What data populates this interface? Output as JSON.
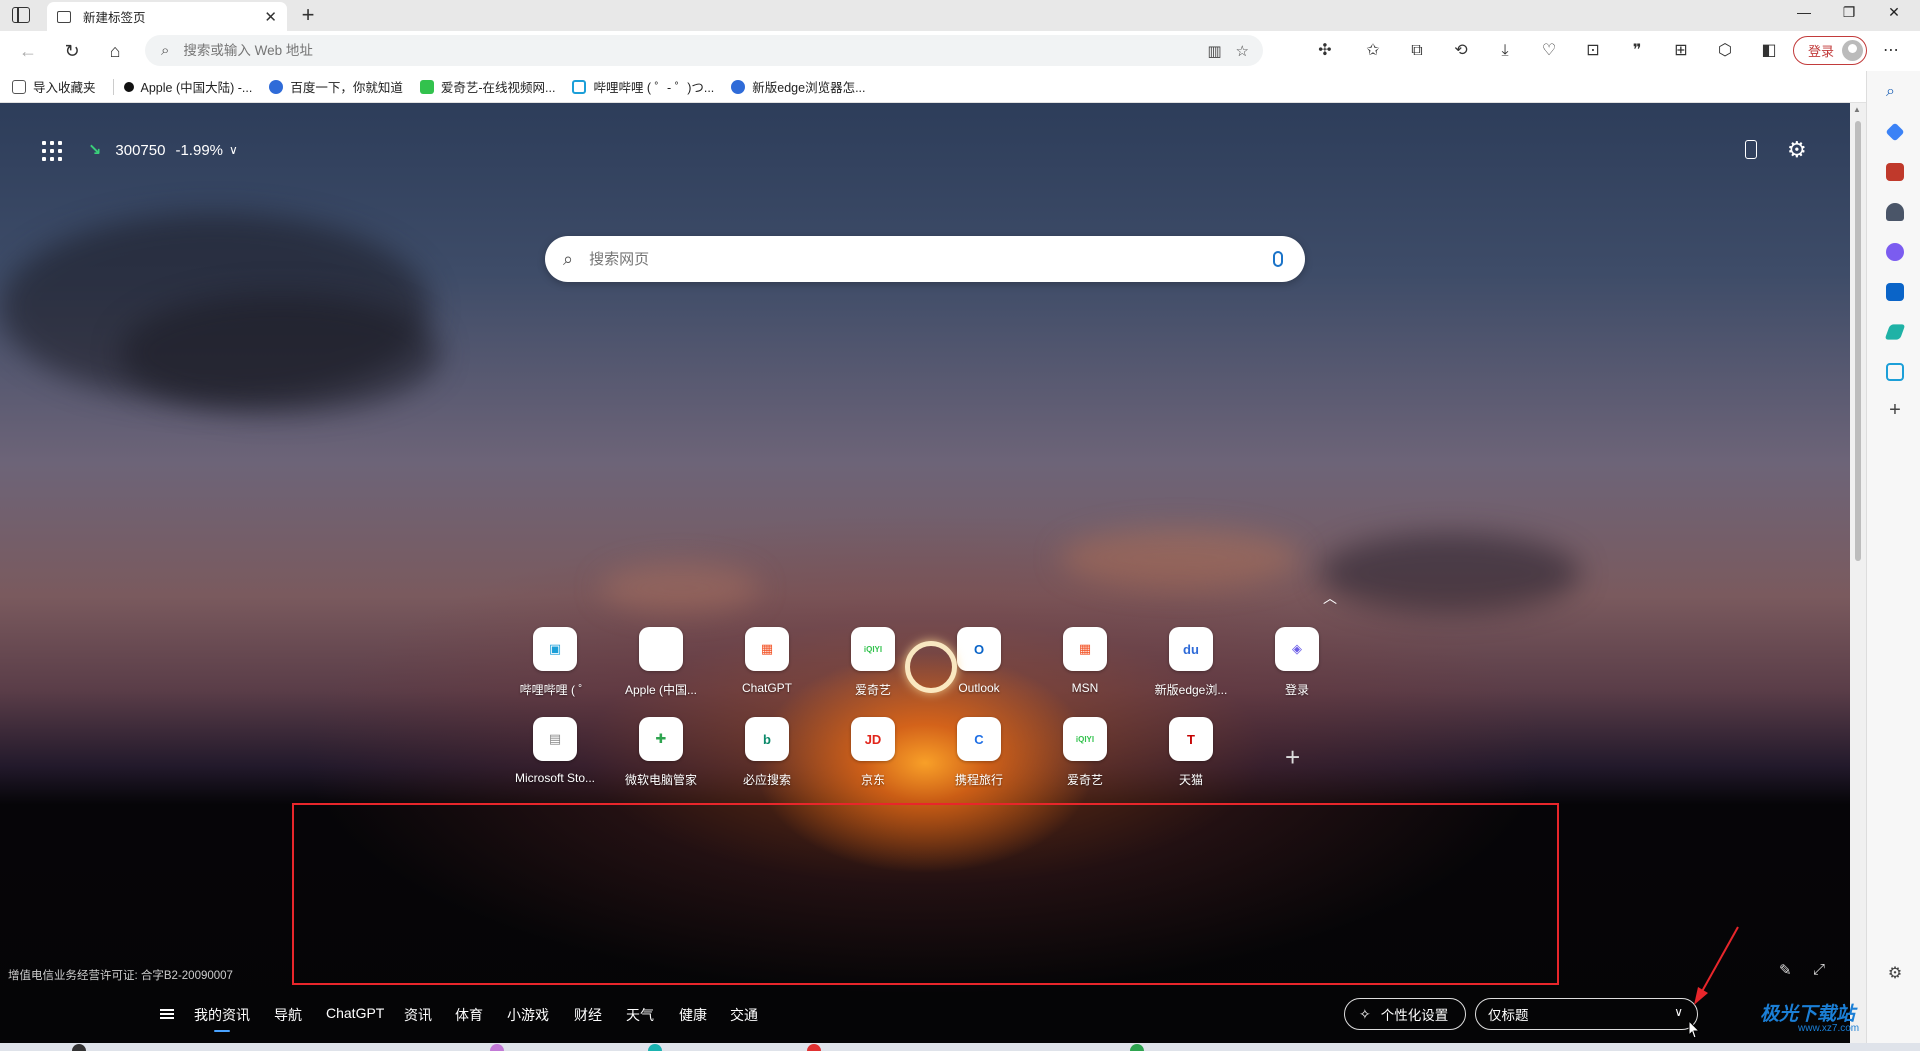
{
  "tab": {
    "title": "新建标签页"
  },
  "address": {
    "placeholder": "搜索或输入 Web 地址"
  },
  "toolbar": {
    "login_label": "登录"
  },
  "bookmarks": [
    {
      "label": "导入收藏夹",
      "icon": "import-icon",
      "color": "#555555"
    },
    {
      "label": "Apple (中国大陆) -...",
      "icon": "apple-icon",
      "color": "#111111"
    },
    {
      "label": "百度一下，你就知道",
      "icon": "baidu-icon",
      "color": "#2f6bd8"
    },
    {
      "label": "爱奇艺-在线视频网...",
      "icon": "iqiyi-icon",
      "color": "#32c24d"
    },
    {
      "label": "哔哩哔哩 ( ゜- ゜)つ...",
      "icon": "bilibili-icon",
      "color": "#1c9fd8"
    },
    {
      "label": "新版edge浏览器怎...",
      "icon": "baidu-icon",
      "color": "#2f6bd8"
    }
  ],
  "stock": {
    "code": "300750",
    "change": "-1.99%",
    "trend": "down"
  },
  "search": {
    "placeholder": "搜索网页"
  },
  "tiles": [
    {
      "label": "哔哩哔哩 ( ゜",
      "icon": "bilibili-icon",
      "color": "#1c9fd8",
      "glyph": "▣"
    },
    {
      "label": "Apple (中国...",
      "icon": "apple-icon",
      "color": "#111111",
      "glyph": ""
    },
    {
      "label": "ChatGPT",
      "icon": "microsoft-icon",
      "color": "#f25022",
      "glyph": "▦"
    },
    {
      "label": "爱奇艺",
      "icon": "iqiyi-icon",
      "color": "#32c24d",
      "glyph": "iQIYI"
    },
    {
      "label": "Outlook",
      "icon": "outlook-icon",
      "color": "#0a64c8",
      "glyph": "O"
    },
    {
      "label": "MSN",
      "icon": "microsoft-icon",
      "color": "#f25022",
      "glyph": "▦"
    },
    {
      "label": "新版edge浏...",
      "icon": "baidu-icon",
      "color": "#2f6bd8",
      "glyph": "du"
    },
    {
      "label": "登录",
      "icon": "copilot-icon",
      "color": "#6b5ce7",
      "glyph": "◈"
    },
    {
      "label": "Microsoft Sto...",
      "icon": "store-icon",
      "color": "#888888",
      "glyph": "▤"
    },
    {
      "label": "微软电脑管家",
      "icon": "pcmanager-icon",
      "color": "#2ea44f",
      "glyph": "✚"
    },
    {
      "label": "必应搜索",
      "icon": "bing-icon",
      "color": "#0c8a6b",
      "glyph": "b"
    },
    {
      "label": "京东",
      "icon": "jd-icon",
      "color": "#e1251b",
      "glyph": "JD"
    },
    {
      "label": "携程旅行",
      "icon": "ctrip-icon",
      "color": "#1f6fe5",
      "glyph": "C"
    },
    {
      "label": "爱奇艺",
      "icon": "iqiyi-icon",
      "color": "#32c24d",
      "glyph": "iQIYI"
    },
    {
      "label": "天猫",
      "icon": "tmall-icon",
      "color": "#c40000",
      "glyph": "T"
    }
  ],
  "license": "增值电信业务经营许可证: 合字B2-20090007",
  "feed_tabs": [
    "我的资讯",
    "导航",
    "ChatGPT",
    "资讯",
    "体育",
    "小游戏",
    "财经",
    "天气",
    "健康",
    "交通"
  ],
  "personalize_label": "个性化设置",
  "layout_select": {
    "value": "仅标题"
  },
  "watermark": {
    "text": "极光下载站",
    "sub": "www.xz7.com"
  },
  "colors": {
    "accent_red": "#e8262b",
    "login_red": "#c23b3b",
    "watermark_blue": "#1b7fd6"
  }
}
